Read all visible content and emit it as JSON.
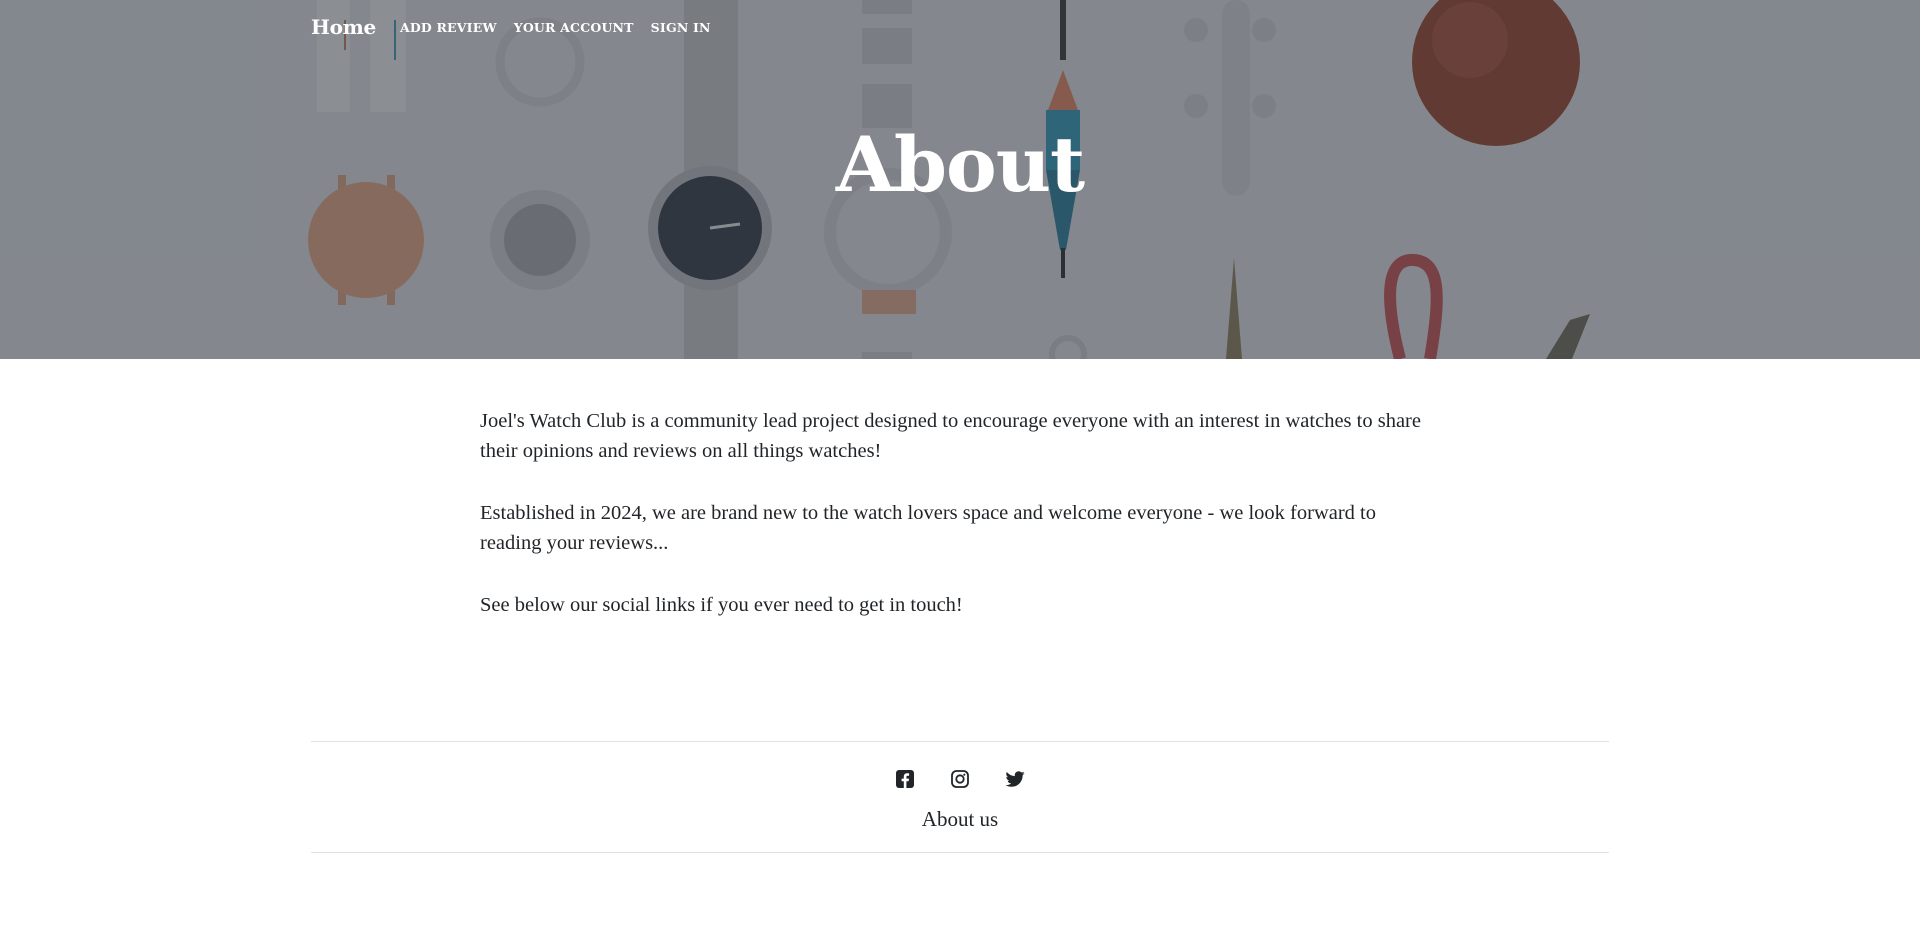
{
  "nav": {
    "brand": "Home",
    "links": [
      "ADD REVIEW",
      "YOUR ACCOUNT",
      "SIGN IN"
    ]
  },
  "hero": {
    "title": "About"
  },
  "content": {
    "paragraphs": [
      "Joel's Watch Club is a community lead project designed to encourage everyone with an interest in watches to share their opinions and reviews on all things watches!",
      "Established in 2024, we are brand new to the watch lovers space and welcome everyone - we look forward to reading your reviews...",
      "See below our social links if you ever need to get in touch!"
    ]
  },
  "footer": {
    "social_icons": [
      "facebook-icon",
      "instagram-icon",
      "twitter-icon"
    ],
    "about_link": "About us"
  },
  "colors": {
    "text": "#212529",
    "hero_overlay": "#343a44",
    "divider": "#dfe1e4"
  }
}
